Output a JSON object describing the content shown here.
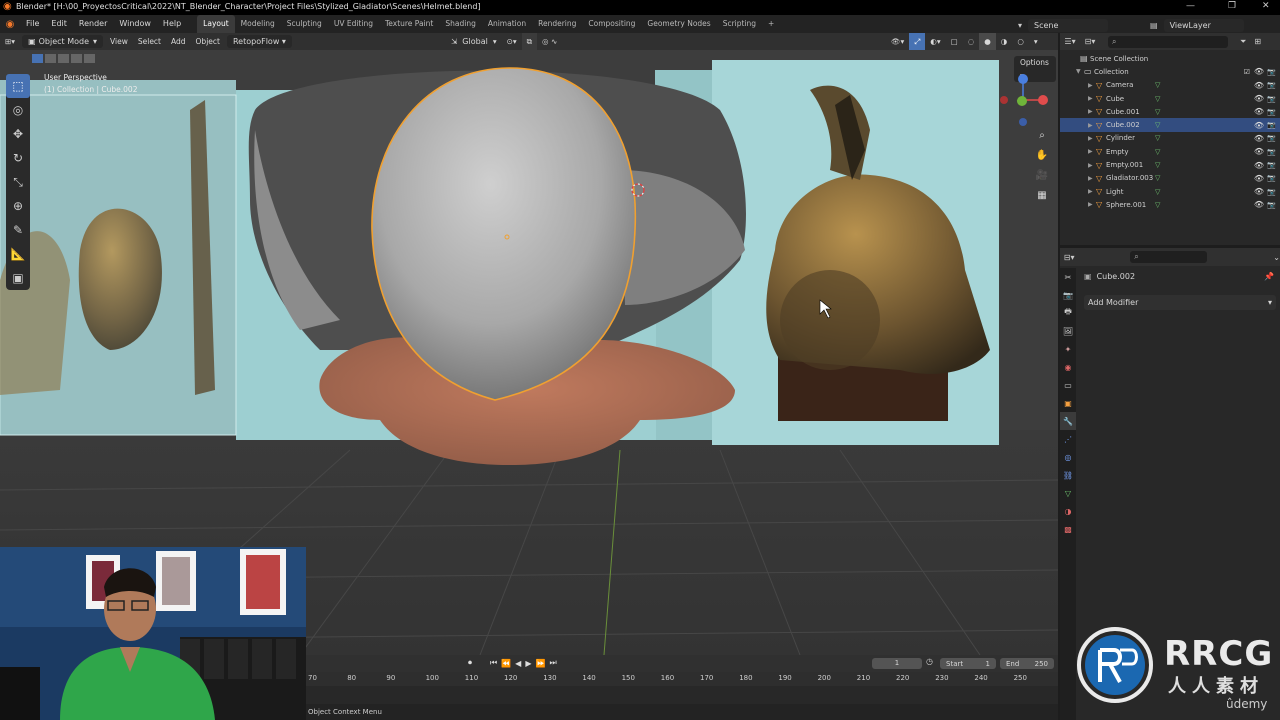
{
  "title_bar": {
    "title": "Blender* [H:\\00_ProyectosCritical\\2022\\NT_Blender_Character\\Project Files\\Stylized_Gladiator\\Scenes\\Helmet.blend]",
    "minimize": "—",
    "maximize": "❐",
    "close": "✕"
  },
  "menu": {
    "items": [
      "File",
      "Edit",
      "Render",
      "Window",
      "Help"
    ],
    "workspaces": [
      "Layout",
      "Modeling",
      "Sculpting",
      "UV Editing",
      "Texture Paint",
      "Shading",
      "Animation",
      "Rendering",
      "Compositing",
      "Geometry Nodes",
      "Scripting"
    ],
    "add_workspace": "+",
    "scene": "Scene",
    "view_layer": "ViewLayer"
  },
  "viewport_header": {
    "mode": "Object Mode",
    "menus": [
      "View",
      "Select",
      "Add",
      "Object"
    ],
    "addon_menu": "RetopoFlow",
    "transform_orientation": "Global",
    "options": "Options"
  },
  "viewport": {
    "view_name": "User Perspective",
    "collection_info": "(1) Collection | Cube.002"
  },
  "outliner": {
    "root": "Scene Collection",
    "collection": "Collection",
    "items": [
      {
        "name": "Camera",
        "selected": false
      },
      {
        "name": "Cube",
        "selected": false
      },
      {
        "name": "Cube.001",
        "selected": false
      },
      {
        "name": "Cube.002",
        "selected": true
      },
      {
        "name": "Cylinder",
        "selected": false
      },
      {
        "name": "Empty",
        "selected": false
      },
      {
        "name": "Empty.001",
        "selected": false
      },
      {
        "name": "Gladiator.003",
        "selected": false
      },
      {
        "name": "Light",
        "selected": false
      },
      {
        "name": "Sphere.001",
        "selected": false
      }
    ]
  },
  "properties": {
    "object_name": "Cube.002",
    "add_modifier": "Add Modifier"
  },
  "timeline": {
    "current_frame": "1",
    "start_label": "Start",
    "start": "1",
    "end_label": "End",
    "end": "250",
    "ticks": [
      "70",
      "80",
      "90",
      "100",
      "110",
      "120",
      "130",
      "140",
      "150",
      "160",
      "170",
      "180",
      "190",
      "200",
      "210",
      "220",
      "230",
      "240",
      "250"
    ]
  },
  "status_bar": {
    "text": "Object Context Menu"
  },
  "watermark": {
    "brand": "RRCG",
    "subtitle": "人人素材",
    "udemy": "ûdemy"
  },
  "colors": {
    "accent": "#4772b3",
    "selection": "#334d80",
    "outline": "#f0a030",
    "backdrop": "#a7d6d8"
  }
}
